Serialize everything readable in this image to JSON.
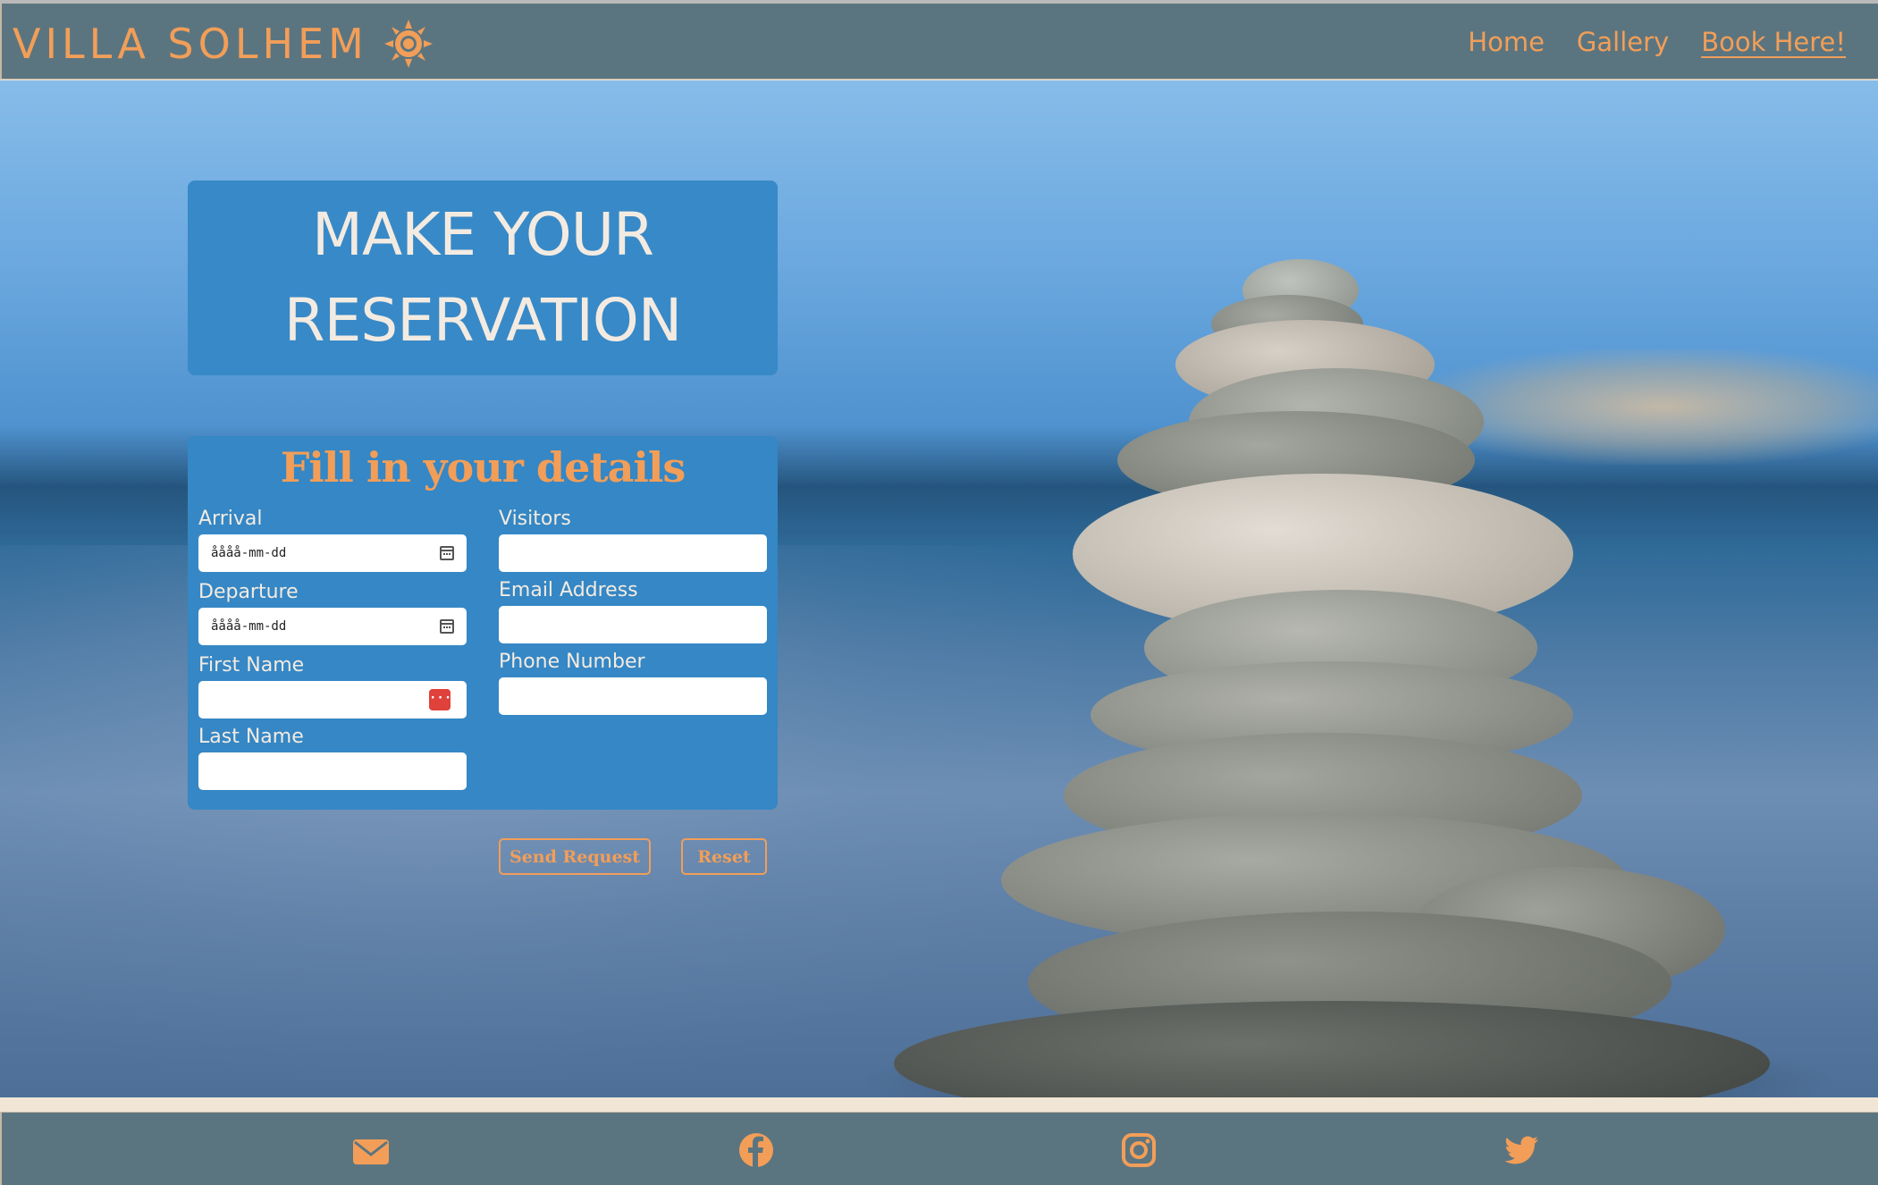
{
  "header": {
    "brand": "VILLA SOLHEM",
    "brand_icon": "sun-icon",
    "nav": [
      {
        "label": "Home"
      },
      {
        "label": "Gallery"
      },
      {
        "label": "Book Here!",
        "active": true
      }
    ]
  },
  "hero": {
    "title_line1": "MAKE YOUR",
    "title_line2": "RESERVATION"
  },
  "form": {
    "heading": "Fill in your details",
    "arrival": {
      "label": "Arrival",
      "placeholder": "åååå-mm-dd"
    },
    "departure": {
      "label": "Departure",
      "placeholder": "åååå-mm-dd"
    },
    "first_name": {
      "label": "First Name",
      "value": ""
    },
    "last_name": {
      "label": "Last Name",
      "value": ""
    },
    "visitors": {
      "label": "Visitors",
      "value": ""
    },
    "email": {
      "label": "Email Address",
      "value": ""
    },
    "phone": {
      "label": "Phone Number",
      "value": ""
    },
    "send_label": "Send Request",
    "reset_label": "Reset"
  },
  "footer": {
    "icons": [
      "envelope-icon",
      "facebook-icon",
      "instagram-icon",
      "twitter-icon"
    ]
  },
  "colors": {
    "bar": "#5b7580",
    "accent": "#f29e58",
    "panel": "#3587c5",
    "cream": "#f3ebe1"
  }
}
